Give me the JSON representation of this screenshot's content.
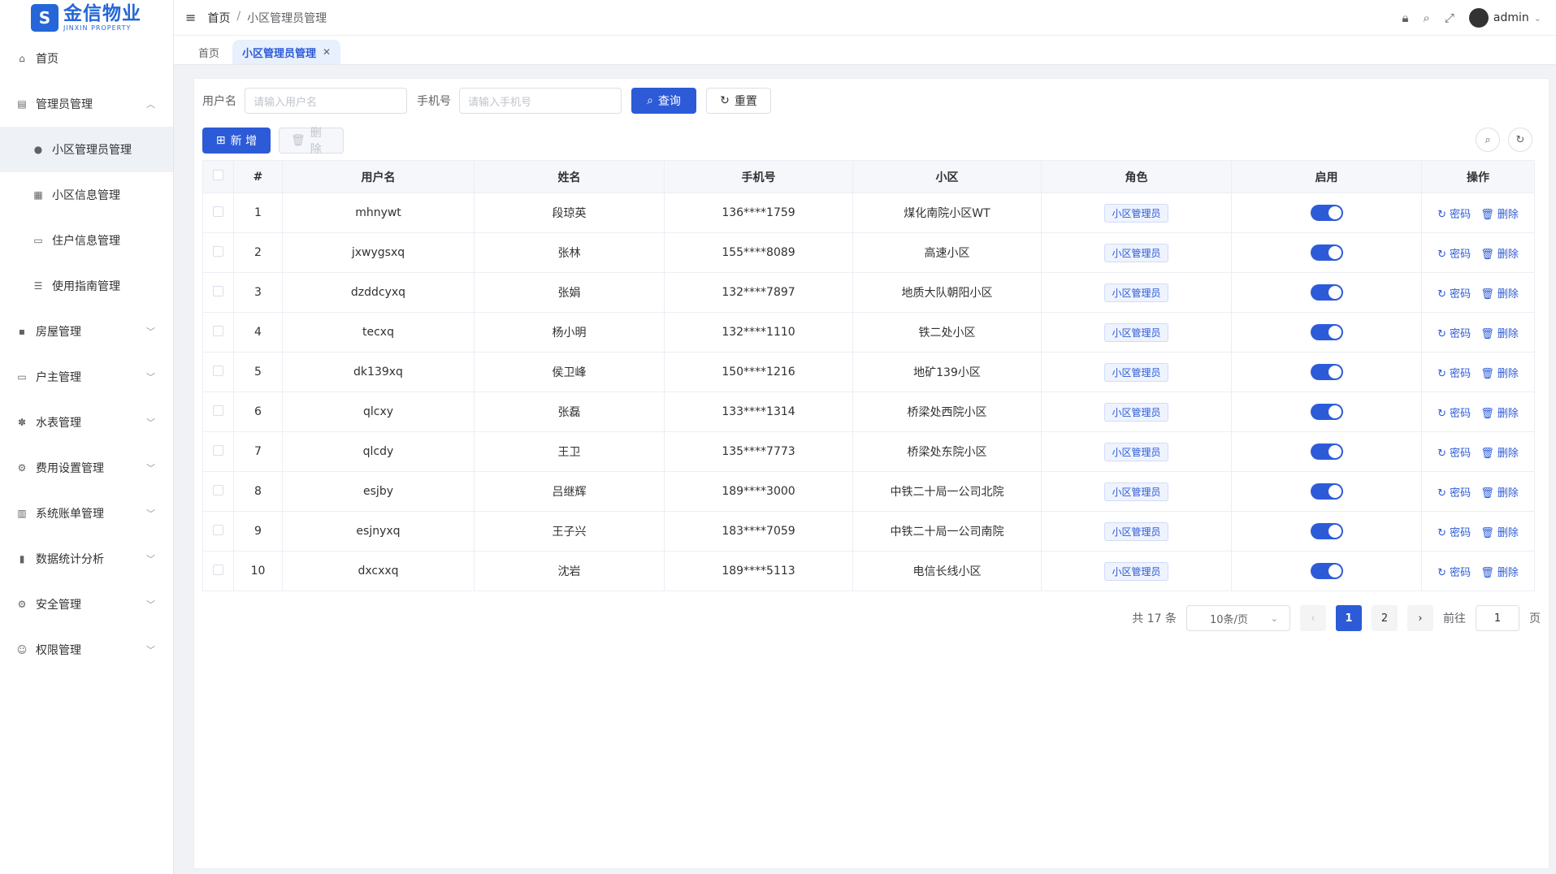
{
  "app": {
    "logo_cn": "金信物业",
    "logo_en": "JINXIN PROPERTY"
  },
  "sidebar": {
    "items": [
      {
        "label": "首页",
        "icon": "home-icon",
        "has_arrow": false
      },
      {
        "label": "管理员管理",
        "icon": "admin-icon",
        "has_arrow": true,
        "expanded": true
      },
      {
        "label": "小区管理员管理",
        "icon": "user-icon",
        "sub": true,
        "active": true
      },
      {
        "label": "小区信息管理",
        "icon": "building-icon",
        "sub": true
      },
      {
        "label": "住户信息管理",
        "icon": "monitor-icon",
        "sub": true
      },
      {
        "label": "使用指南管理",
        "icon": "guide-icon",
        "sub": true
      },
      {
        "label": "房屋管理",
        "icon": "grid-icon",
        "has_arrow": true
      },
      {
        "label": "户主管理",
        "icon": "monitor-icon",
        "has_arrow": true
      },
      {
        "label": "水表管理",
        "icon": "fan-icon",
        "has_arrow": true
      },
      {
        "label": "费用设置管理",
        "icon": "setting-icon",
        "has_arrow": true
      },
      {
        "label": "系统账单管理",
        "icon": "bill-icon",
        "has_arrow": true
      },
      {
        "label": "数据统计分析",
        "icon": "chart-icon",
        "has_arrow": true
      },
      {
        "label": "安全管理",
        "icon": "setting-icon",
        "has_arrow": true
      },
      {
        "label": "权限管理",
        "icon": "person-icon",
        "has_arrow": true
      }
    ]
  },
  "header": {
    "breadcrumb": [
      "首页",
      "小区管理员管理"
    ],
    "user": "admin"
  },
  "tabs": [
    {
      "label": "首页",
      "active": false
    },
    {
      "label": "小区管理员管理",
      "active": true
    }
  ],
  "filters": {
    "username_label": "用户名",
    "username_placeholder": "请输入用户名",
    "phone_label": "手机号",
    "phone_placeholder": "请输入手机号",
    "search_label": "查询",
    "reset_label": "重置"
  },
  "toolbar": {
    "add_label": "新 增",
    "delete_label": "删除"
  },
  "table": {
    "columns": [
      "#",
      "用户名",
      "姓名",
      "手机号",
      "小区",
      "角色",
      "启用",
      "操作"
    ],
    "rows": [
      {
        "no": "1",
        "username": "mhnywt",
        "name": "段琼英",
        "phone": "136****1759",
        "community": "煤化南院小区WT",
        "role": "小区管理员"
      },
      {
        "no": "2",
        "username": "jxwygsxq",
        "name": "张林",
        "phone": "155****8089",
        "community": "高速小区",
        "role": "小区管理员"
      },
      {
        "no": "3",
        "username": "dzddcyxq",
        "name": "张娟",
        "phone": "132****7897",
        "community": "地质大队朝阳小区",
        "role": "小区管理员"
      },
      {
        "no": "4",
        "username": "tecxq",
        "name": "杨小明",
        "phone": "132****1110",
        "community": "铁二处小区",
        "role": "小区管理员"
      },
      {
        "no": "5",
        "username": "dk139xq",
        "name": "侯卫峰",
        "phone": "150****1216",
        "community": "地矿139小区",
        "role": "小区管理员"
      },
      {
        "no": "6",
        "username": "qlcxy",
        "name": "张磊",
        "phone": "133****1314",
        "community": "桥梁处西院小区",
        "role": "小区管理员"
      },
      {
        "no": "7",
        "username": "qlcdy",
        "name": "王卫",
        "phone": "135****7773",
        "community": "桥梁处东院小区",
        "role": "小区管理员"
      },
      {
        "no": "8",
        "username": "esjby",
        "name": "吕继辉",
        "phone": "189****3000",
        "community": "中铁二十局一公司北院",
        "role": "小区管理员"
      },
      {
        "no": "9",
        "username": "esjnyxq",
        "name": "王子兴",
        "phone": "183****7059",
        "community": "中铁二十局一公司南院",
        "role": "小区管理员"
      },
      {
        "no": "10",
        "username": "dxcxxq",
        "name": "沈岩",
        "phone": "189****5113",
        "community": "电信长线小区",
        "role": "小区管理员"
      }
    ],
    "op_password": "密码",
    "op_delete": "删除"
  },
  "pagination": {
    "total": "共 17 条",
    "page_size": "10条/页",
    "pages": [
      "1",
      "2"
    ],
    "current": "1",
    "goto_label": "前往",
    "goto_value": "1",
    "page_suffix": "页"
  },
  "colors": {
    "primary": "#2d5bd7",
    "brand": "#2566d8"
  }
}
